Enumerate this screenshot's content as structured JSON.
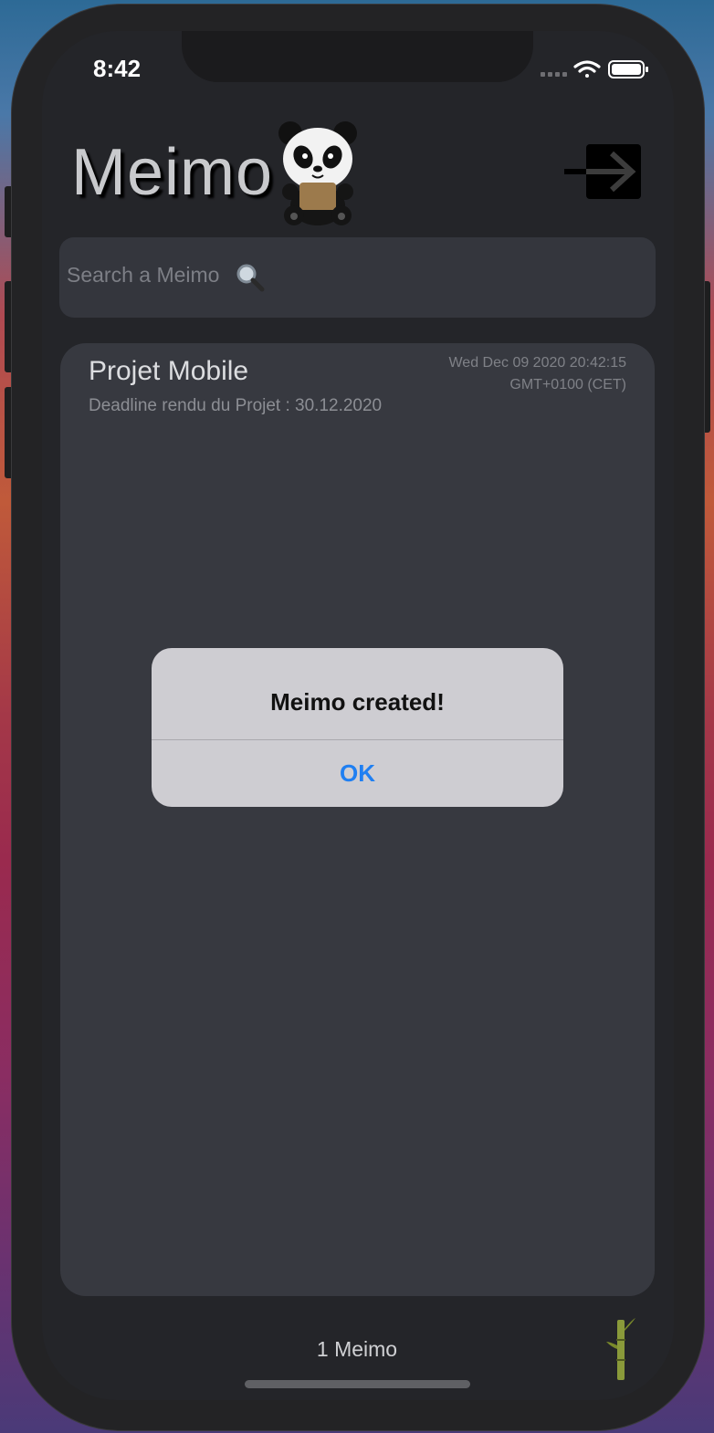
{
  "status_bar": {
    "time": "8:42"
  },
  "header": {
    "title": "Meimo"
  },
  "search": {
    "placeholder": "Search a Meimo"
  },
  "memos": [
    {
      "title": "Projet Mobile",
      "description": "Deadline rendu du Projet : 30.12.2020",
      "date_line1": "Wed Dec 09 2020 20:42:15",
      "date_line2": "GMT+0100 (CET)"
    }
  ],
  "alert": {
    "title": "Meimo created!",
    "button": "OK"
  },
  "footer": {
    "count": "1 Meimo"
  },
  "colors": {
    "accent": "#1f7ff2",
    "background": "#242529",
    "card": "#373940"
  },
  "icons": [
    "panda-logo-icon",
    "logout-icon",
    "search-icon",
    "bamboo-icon",
    "wifi-icon",
    "battery-icon",
    "signal-icon"
  ]
}
